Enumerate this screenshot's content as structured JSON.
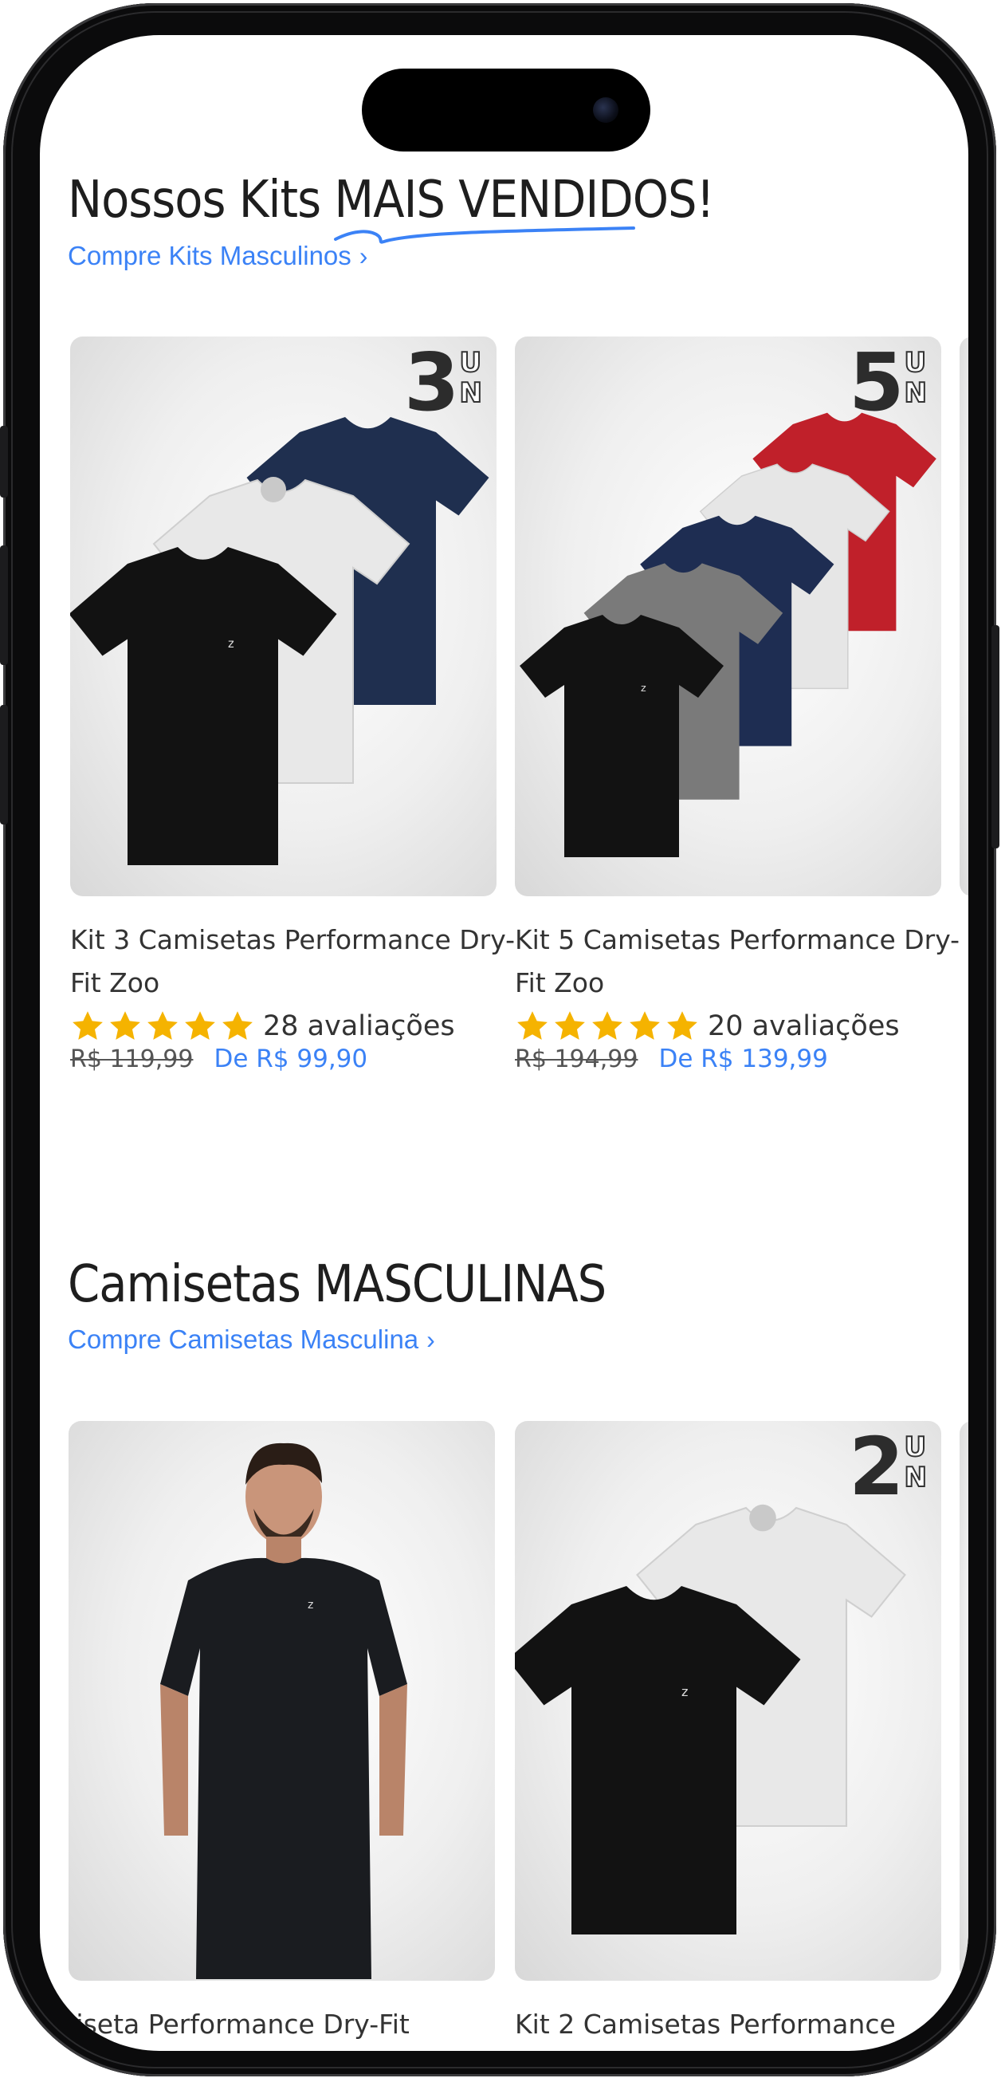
{
  "section_kits": {
    "title_prefix": "Nossos Kits ",
    "title_highlight": "MAIS VENDIDOS!",
    "link_label": "Compre Kits Masculinos",
    "products": [
      {
        "badge_number": "3",
        "title": "Kit 3 Camisetas Performance Dry-Fit Zoo",
        "rating_stars": 5,
        "reviews": "28 avaliações",
        "old_price": "R$ 119,99",
        "new_price": "De R$ 99,90",
        "shirt_colors": [
          "#1f2f4f",
          "#e8e8e8",
          "#121212"
        ]
      },
      {
        "badge_number": "5",
        "title": "Kit 5 Camisetas Performance Dry-Fit Zoo",
        "rating_stars": 5,
        "reviews": "20 avaliações",
        "old_price": "R$ 194,99",
        "new_price": "De R$ 139,99",
        "shirt_colors": [
          "#c0202a",
          "#e6e6e6",
          "#1e2d52",
          "#7a7a7a",
          "#121212"
        ]
      }
    ]
  },
  "section_camisetas": {
    "title": "Camisetas MASCULINAS",
    "link_label": "Compre Camisetas Masculina",
    "products": [
      {
        "title": "Camiseta Performance Dry-Fit",
        "image": "man-wearing-black-tshirt"
      },
      {
        "badge_number": "2",
        "title": "Kit 2 Camisetas Performance",
        "shirt_colors": [
          "#e8e8e8",
          "#121212"
        ]
      }
    ]
  },
  "badge_unit_top": "U",
  "badge_unit_bottom": "N",
  "colors": {
    "accent": "#3b82f6",
    "star": "#f5b300",
    "text": "#333333",
    "frame": "#0b0b0c"
  },
  "icons": [
    "chevron-right-icon",
    "star-icon"
  ]
}
